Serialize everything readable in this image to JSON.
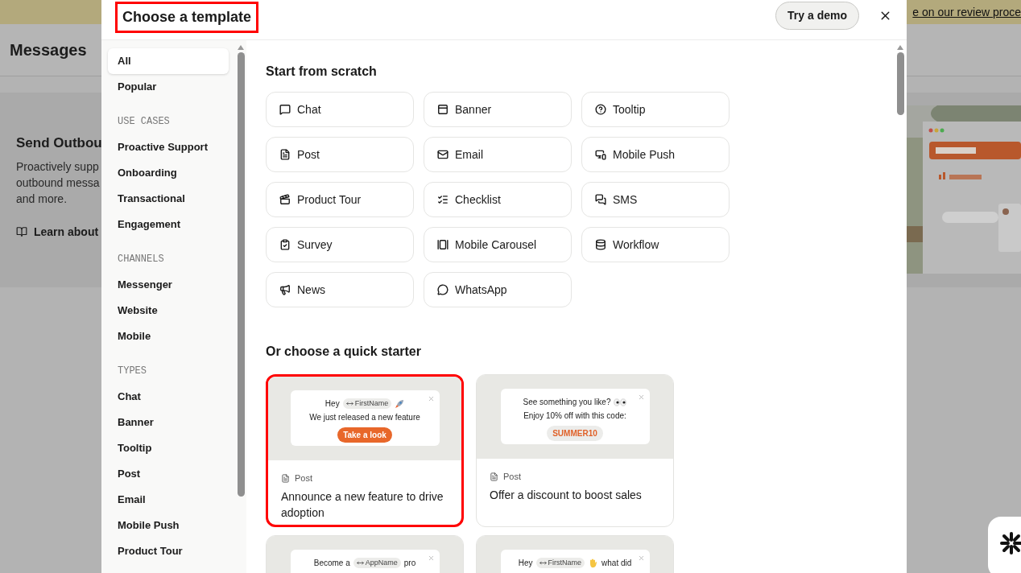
{
  "background": {
    "banner_link": "e on our review proce",
    "title": "Messages",
    "hero": {
      "heading": "Send Outbou",
      "lines": [
        "Proactively supp",
        "outbound messa",
        "and more."
      ],
      "link": "Learn about"
    }
  },
  "modal": {
    "title": "Choose a template",
    "title_highlighted": true,
    "demo_button": "Try a demo"
  },
  "sidebar": {
    "items": [
      {
        "kind": "item",
        "label": "All",
        "selected": true
      },
      {
        "kind": "item",
        "label": "Popular",
        "selected": false
      },
      {
        "kind": "heading",
        "label": "USE CASES"
      },
      {
        "kind": "item",
        "label": "Proactive Support",
        "selected": false
      },
      {
        "kind": "item",
        "label": "Onboarding",
        "selected": false
      },
      {
        "kind": "item",
        "label": "Transactional",
        "selected": false
      },
      {
        "kind": "item",
        "label": "Engagement",
        "selected": false
      },
      {
        "kind": "heading",
        "label": "CHANNELS"
      },
      {
        "kind": "item",
        "label": "Messenger",
        "selected": false
      },
      {
        "kind": "item",
        "label": "Website",
        "selected": false
      },
      {
        "kind": "item",
        "label": "Mobile",
        "selected": false
      },
      {
        "kind": "heading",
        "label": "TYPES"
      },
      {
        "kind": "item",
        "label": "Chat",
        "selected": false
      },
      {
        "kind": "item",
        "label": "Banner",
        "selected": false
      },
      {
        "kind": "item",
        "label": "Tooltip",
        "selected": false
      },
      {
        "kind": "item",
        "label": "Post",
        "selected": false
      },
      {
        "kind": "item",
        "label": "Email",
        "selected": false
      },
      {
        "kind": "item",
        "label": "Mobile Push",
        "selected": false
      },
      {
        "kind": "item",
        "label": "Product Tour",
        "selected": false
      }
    ]
  },
  "scratch": {
    "heading": "Start from scratch",
    "types": [
      "Chat",
      "Banner",
      "Tooltip",
      "Post",
      "Email",
      "Mobile Push",
      "Product Tour",
      "Checklist",
      "SMS",
      "Survey",
      "Mobile Carousel",
      "Workflow",
      "News",
      "WhatsApp"
    ]
  },
  "starters": {
    "heading": "Or choose a quick starter",
    "cards": [
      {
        "highlighted": true,
        "preview": [
          [
            {
              "kind": "text",
              "text": "Hey"
            },
            {
              "kind": "chip",
              "text": "FirstName"
            },
            {
              "kind": "emoji"
            }
          ],
          [
            {
              "kind": "text",
              "text": "We just released a new feature"
            }
          ],
          [
            {
              "kind": "button",
              "text": "Take a look"
            }
          ]
        ],
        "type": "Post",
        "title": "Announce a new feature to drive adoption"
      },
      {
        "highlighted": false,
        "preview": [
          [
            {
              "kind": "text",
              "text": "See something you like?"
            },
            {
              "kind": "emoji"
            }
          ],
          [
            {
              "kind": "text",
              "text": "Enjoy 10% off with this code:"
            }
          ],
          [
            {
              "kind": "code",
              "text": "SUMMER10"
            }
          ]
        ],
        "type": "Post",
        "title": "Offer a discount to boost sales"
      },
      {
        "highlighted": false,
        "preview": [
          [
            {
              "kind": "text",
              "text": "Become a"
            },
            {
              "kind": "chip",
              "text": "AppName"
            },
            {
              "kind": "text",
              "text": "pro"
            }
          ]
        ]
      },
      {
        "highlighted": false,
        "preview": [
          [
            {
              "kind": "text",
              "text": "Hey"
            },
            {
              "kind": "chip",
              "text": "FirstName"
            },
            {
              "kind": "emoji"
            },
            {
              "kind": "text",
              "text": "what did"
            }
          ]
        ]
      }
    ]
  }
}
